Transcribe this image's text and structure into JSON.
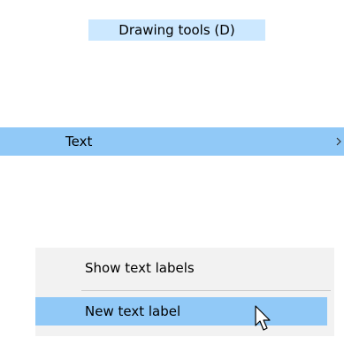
{
  "menu_button": {
    "label": "Drawing tools (D)"
  },
  "menu_item": {
    "label": "Text",
    "submenu_indicator": "chevron-right-icon"
  },
  "submenu": {
    "items": [
      {
        "label": "Show text labels",
        "state": "normal"
      },
      {
        "label": "New text label",
        "state": "highlighted"
      }
    ]
  },
  "cursor": {
    "icon": "mouse-pointer-icon"
  },
  "colors": {
    "button_highlight": "#cce8ff",
    "menu_highlight": "#91c9f7",
    "menu_background": "#f2f2f2",
    "separator": "#cccccc"
  }
}
